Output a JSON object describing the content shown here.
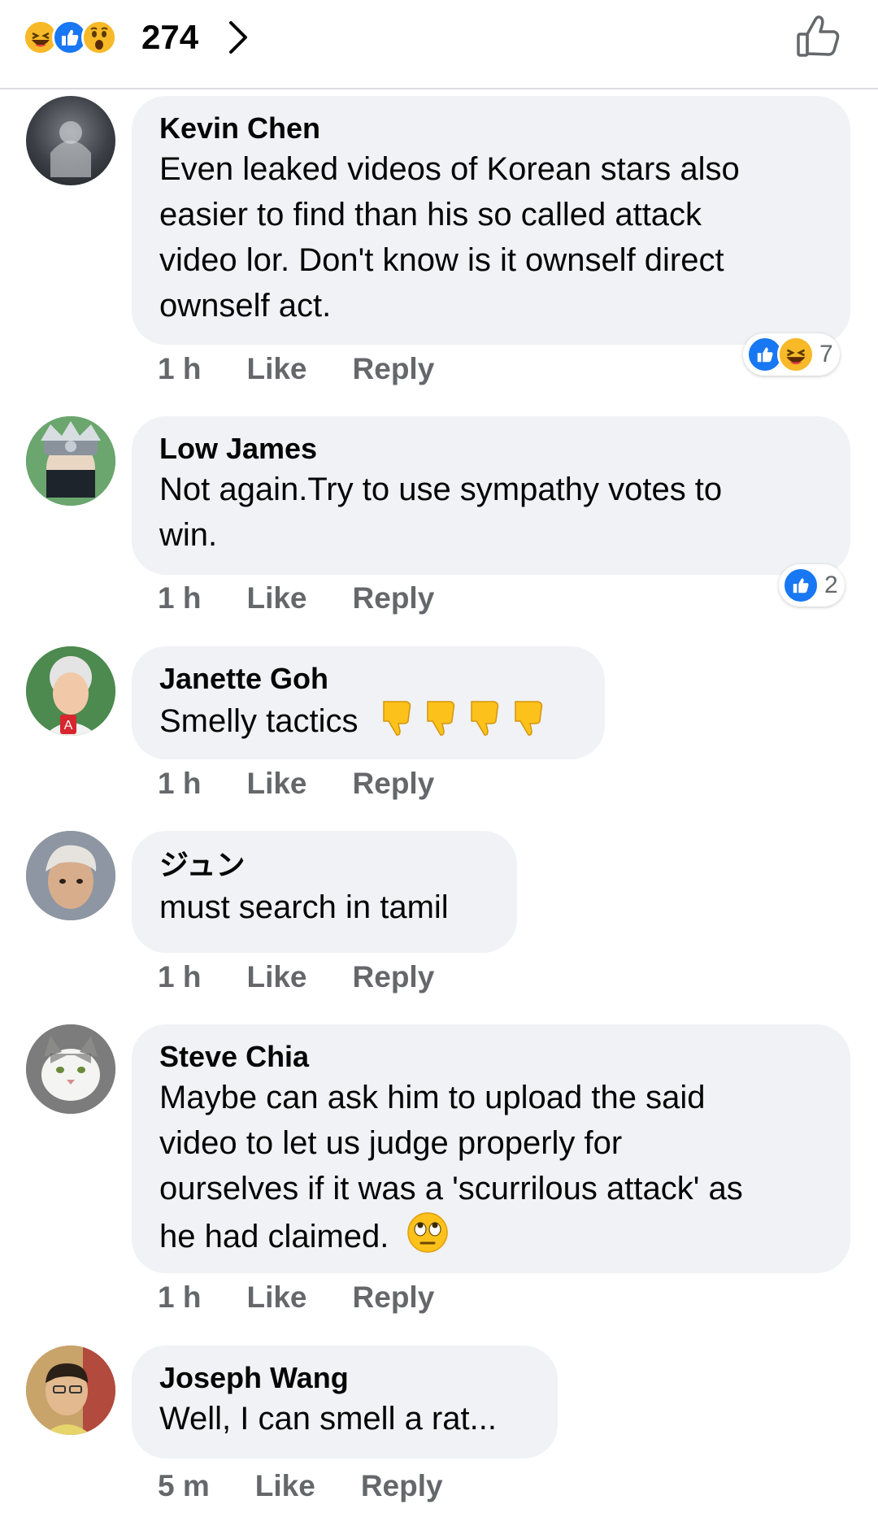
{
  "header": {
    "reaction_count": "274",
    "reactions": [
      "haha-icon",
      "like-icon",
      "wow-icon"
    ]
  },
  "comments": [
    {
      "name": "Kevin Chen",
      "lines": [
        "Even leaked videos of Korean stars also",
        "easier to find than his so called attack",
        "video lor. Don't know is it ownself direct",
        "ownself act."
      ],
      "time": "1 h",
      "like": "Like",
      "reply": "Reply",
      "reaction_count": "7"
    },
    {
      "name": "Low James",
      "lines": [
        "Not again.Try to use sympathy votes to",
        "win."
      ],
      "time": "1 h",
      "like": "Like",
      "reply": "Reply",
      "reaction_count": "2"
    },
    {
      "name": "Janette Goh",
      "lines": [
        "Smelly tactics"
      ],
      "time": "1 h",
      "like": "Like",
      "reply": "Reply"
    },
    {
      "name": "ジュン",
      "lines": [
        "must search in tamil"
      ],
      "time": "1 h",
      "like": "Like",
      "reply": "Reply"
    },
    {
      "name": "Steve Chia",
      "lines": [
        "Maybe can ask him to upload the said",
        "video to let us judge properly for",
        "ourselves if it was a 'scurrilous attack' as",
        "he had claimed."
      ],
      "time": "1 h",
      "like": "Like",
      "reply": "Reply"
    },
    {
      "name": "Joseph Wang",
      "lines": [
        "Well, I can smell a rat..."
      ],
      "time": "5 m",
      "like": "Like",
      "reply": "Reply"
    }
  ]
}
